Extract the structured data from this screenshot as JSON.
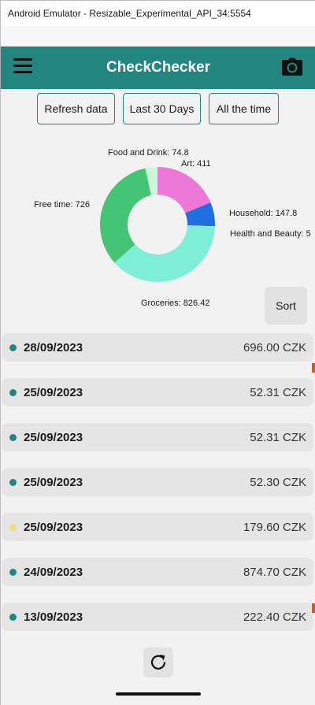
{
  "window": {
    "title": "Android Emulator - Resizable_Experimental_API_34:5554"
  },
  "appbar": {
    "title": "CheckChecker",
    "menu_icon": "hamburger-menu-icon",
    "camera_icon": "camera-icon"
  },
  "filters": [
    {
      "label": "Refresh data"
    },
    {
      "label": "Last 30 Days"
    },
    {
      "label": "All the time"
    }
  ],
  "chart_data": {
    "type": "pie",
    "donut": true,
    "slices": [
      {
        "label": "Art",
        "value": 411,
        "color": "#ee78d8"
      },
      {
        "label": "Household",
        "value": 147.8,
        "color": "#1f6fe0"
      },
      {
        "label": "Health and Beauty",
        "value": 5,
        "color": "#d2f2ea"
      },
      {
        "label": "Groceries",
        "value": 826.42,
        "color": "#7eefd6"
      },
      {
        "label": "Free time",
        "value": 726,
        "color": "#45c476"
      },
      {
        "label": "Food and Drink",
        "value": 74.8,
        "color": "#ccf6d8"
      }
    ],
    "label_texts": [
      "Art: 411",
      "Household: 147.8",
      "Health and Beauty: 5",
      "Groceries: 826.42",
      "Free time: 726",
      "Food and Drink: 74.8"
    ]
  },
  "sort": {
    "label": "Sort"
  },
  "receipts": [
    {
      "date": "28/09/2023",
      "amount": "696.00 CZK",
      "dot_color": "#23857f"
    },
    {
      "date": "25/09/2023",
      "amount": "52.31 CZK",
      "dot_color": "#23857f"
    },
    {
      "date": "25/09/2023",
      "amount": "52.31 CZK",
      "dot_color": "#23857f"
    },
    {
      "date": "25/09/2023",
      "amount": "52.30 CZK",
      "dot_color": "#23857f"
    },
    {
      "date": "25/09/2023",
      "amount": "179.60 CZK",
      "dot_color": "#f3dc7a"
    },
    {
      "date": "24/09/2023",
      "amount": "874.70 CZK",
      "dot_color": "#23857f"
    },
    {
      "date": "13/09/2023",
      "amount": "222.40 CZK",
      "dot_color": "#23857f"
    }
  ],
  "bottom": {
    "refresh_icon": "refresh-icon"
  }
}
